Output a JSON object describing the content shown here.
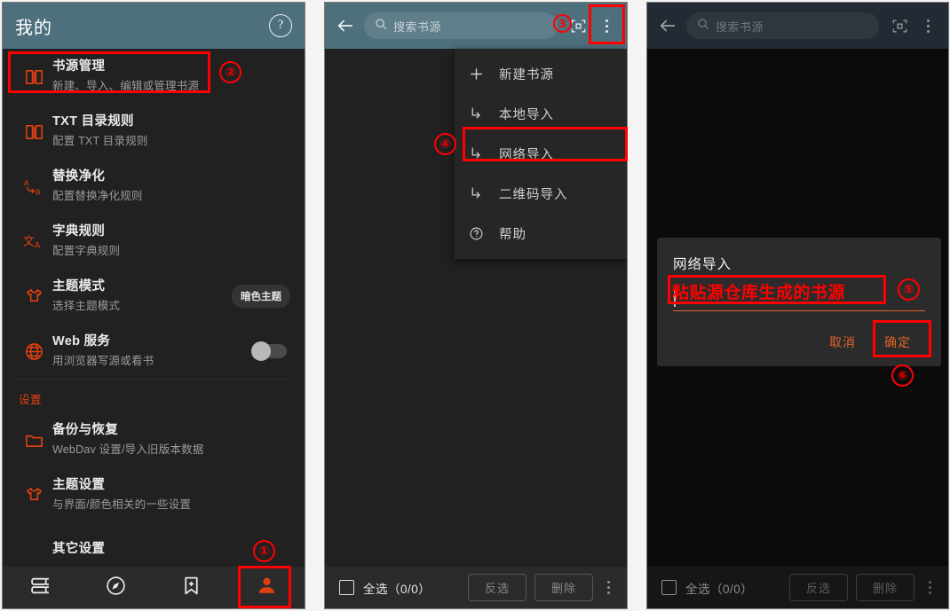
{
  "theme": {
    "appbar_teal": "#4e707d",
    "accent_orange": "#e04010",
    "dialog_accent": "#e0622a",
    "annotation_red": "#ff0000",
    "panel_bg": "#212121"
  },
  "panel1": {
    "appbar": {
      "title": "我的",
      "help_icon": "help-circle-icon",
      "help_glyph": "?"
    },
    "items": [
      {
        "icon": "book-open-icon",
        "title": "书源管理",
        "subtitle": "新建、导入、编辑或管理书源"
      },
      {
        "icon": "book-open-icon",
        "title": "TXT 目录规则",
        "subtitle": "配置 TXT 目录规则"
      },
      {
        "icon": "replace-ab-icon",
        "title": "替换净化",
        "subtitle": "配置替换净化规则"
      },
      {
        "icon": "translate-icon",
        "title": "字典规则",
        "subtitle": "配置字典规则"
      },
      {
        "icon": "tshirt-icon",
        "title": "主题模式",
        "subtitle": "选择主题模式",
        "chip": "暗色主题"
      },
      {
        "icon": "globe-icon",
        "title": "Web 服务",
        "subtitle": "用浏览器写源或看书",
        "toggle": "off"
      }
    ],
    "section_label": "设置",
    "settings_items": [
      {
        "icon": "folder-icon",
        "title": "备份与恢复",
        "subtitle": "WebDav 设置/导入旧版本数据"
      },
      {
        "icon": "tshirt-icon",
        "title": "主题设置",
        "subtitle": "与界面/颜色相关的一些设置"
      },
      {
        "icon": "gear-icon",
        "title": "其它设置",
        "subtitle": ""
      }
    ],
    "bottom_nav": [
      {
        "icon": "bookshelf-icon",
        "label": "",
        "active": false
      },
      {
        "icon": "compass-icon",
        "label": "",
        "active": false
      },
      {
        "icon": "bookmark-plus-icon",
        "label": "",
        "active": false
      },
      {
        "icon": "person-icon",
        "label": "",
        "active": true
      }
    ]
  },
  "panel2": {
    "appbar": {
      "back_icon": "back-arrow-icon",
      "search_placeholder": "搜索书源",
      "search_icon": "search-icon",
      "group_icon": "qr-scan-icon",
      "overflow_icon": "kebab-menu-icon"
    },
    "menu": [
      {
        "icon": "plus-icon",
        "label": "新建书源"
      },
      {
        "icon": "import-arrow-icon",
        "label": "本地导入"
      },
      {
        "icon": "import-arrow-icon",
        "label": "网络导入"
      },
      {
        "icon": "import-arrow-icon",
        "label": "二维码导入"
      },
      {
        "icon": "help-circle-icon",
        "label": "帮助"
      }
    ],
    "toolbar": {
      "checkbox_icon": "checkbox-unchecked-icon",
      "select_all_label": "全选（0/0）",
      "invert_label": "反选",
      "delete_label": "删除",
      "overflow_icon": "kebab-menu-icon"
    }
  },
  "panel3": {
    "appbar": {
      "back_icon": "back-arrow-icon",
      "search_placeholder": "搜索书源",
      "search_icon": "search-icon",
      "group_icon": "qr-scan-icon",
      "overflow_icon": "kebab-menu-icon"
    },
    "dialog": {
      "title": "网络导入",
      "input_value": "",
      "cancel_label": "取消",
      "confirm_label": "确定"
    },
    "toolbar": {
      "checkbox_icon": "checkbox-unchecked-icon",
      "select_all_label": "全选（0/0）",
      "invert_label": "反选",
      "delete_label": "删除",
      "overflow_icon": "kebab-menu-icon"
    }
  },
  "annotations": {
    "step1": "①",
    "step2": "②",
    "step3": "3",
    "step4": "④",
    "step5": "⑤",
    "step6": "⑥",
    "note5_text": "粘贴源仓库生成的书源"
  }
}
